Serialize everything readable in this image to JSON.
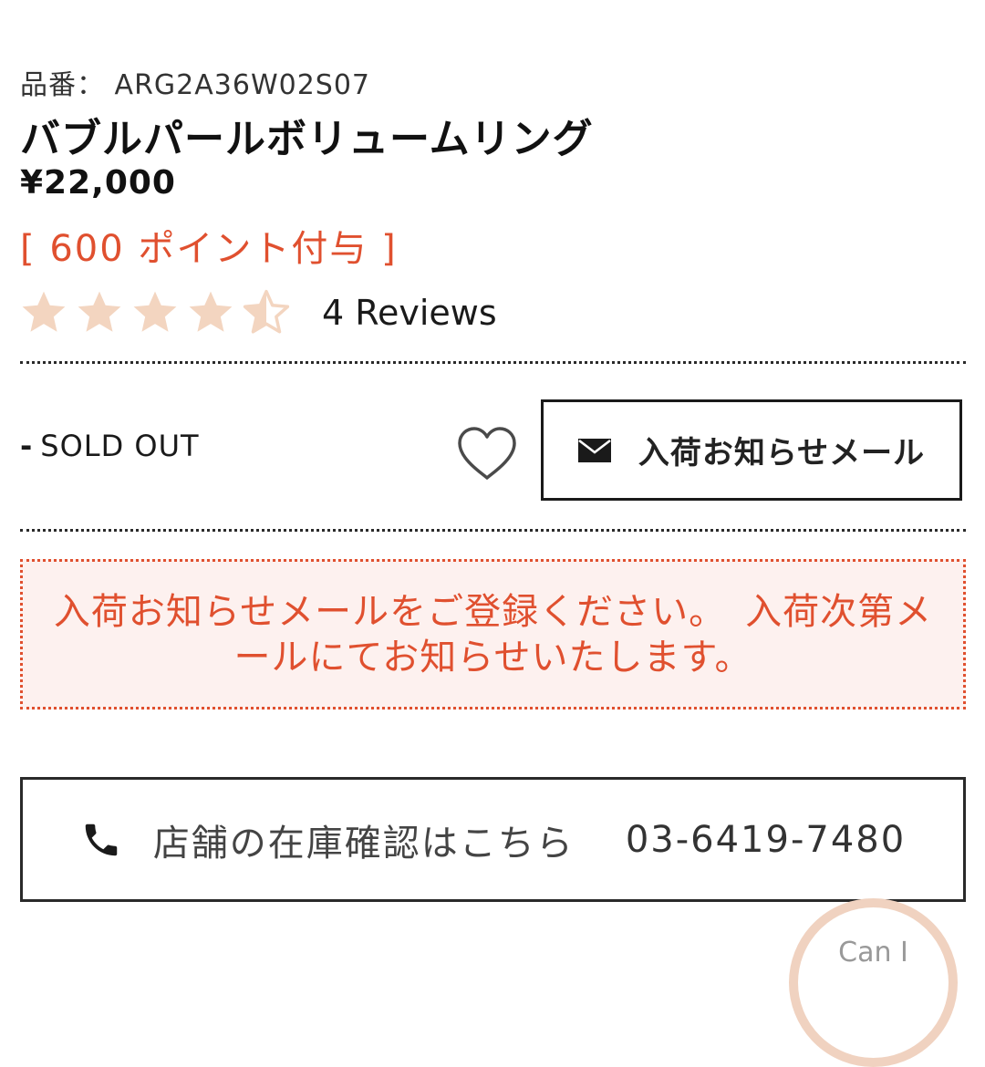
{
  "product": {
    "code_label": "品番：",
    "code": "ARG2A36W02S07",
    "title": "バブルパールボリュームリング",
    "price": "¥22,000",
    "points": "[ 600 ポイント付与 ]"
  },
  "rating": {
    "value": 4.5,
    "max": 5,
    "star_color": "#f3d5c0",
    "reviews_label": "4 Reviews"
  },
  "stock": {
    "status_dash": "-",
    "status": "SOLD OUT"
  },
  "actions": {
    "favorite_icon": "heart-icon",
    "notify_icon": "mail-icon",
    "notify_label": "入荷お知らせメール"
  },
  "notice": {
    "text": "入荷お知らせメールをご登録ください。　入荷次第メールにてお知らせいたします。",
    "color": "#e0502f"
  },
  "store_stock": {
    "icon": "phone-icon",
    "label": "店舗の在庫確認はこちら",
    "phone": "03-6419-7480"
  },
  "chat": {
    "label": "Can I"
  }
}
